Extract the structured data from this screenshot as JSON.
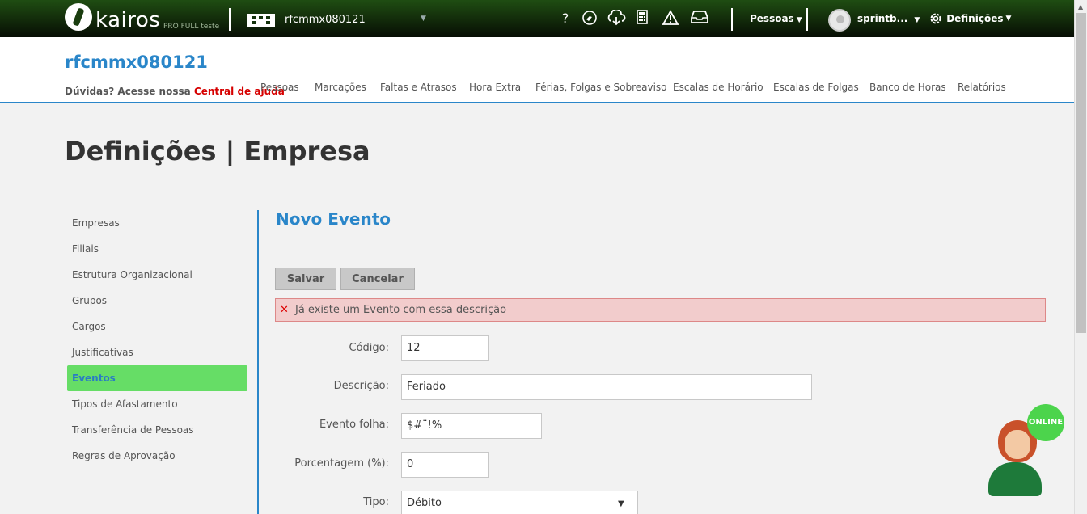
{
  "topbar": {
    "logo_text": "kairos",
    "logo_sub": "PRO FULL teste",
    "company": "rfcmmx080121",
    "icons": [
      "help-icon",
      "feedback-icon",
      "cloud-download-icon",
      "calculator-icon",
      "warning-icon",
      "inbox-icon"
    ],
    "help_glyph": "?",
    "pessoas_label": "Pessoas",
    "user_label": "sprintb...",
    "definicoes_label": "Definições"
  },
  "header": {
    "title": "rfcmmx080121",
    "help_prefix": "Dúvidas? Acesse nossa",
    "help_link": "Central de ajuda",
    "nav": [
      "Pessoas",
      "Marcações",
      "Faltas e Atrasos",
      "Hora Extra",
      "Férias, Folgas e Sobreaviso",
      "Escalas de Horário",
      "Escalas de Folgas",
      "Banco de Horas",
      "Relatórios"
    ]
  },
  "page_title": "Definições | Empresa",
  "sidebar": {
    "items": [
      "Empresas",
      "Filiais",
      "Estrutura Organizacional",
      "Grupos",
      "Cargos",
      "Justificativas",
      "Eventos",
      "Tipos de Afastamento",
      "Transferência de Pessoas",
      "Regras de Aprovação"
    ],
    "active": "Eventos"
  },
  "form": {
    "title": "Novo Evento",
    "save_label": "Salvar",
    "cancel_label": "Cancelar",
    "alert": "Já existe um Evento com essa descrição",
    "fields": {
      "codigo": {
        "label": "Código:",
        "value": "12"
      },
      "descricao": {
        "label": "Descrição:",
        "value": "Feriado"
      },
      "evento_folha": {
        "label": "Evento folha:",
        "value": "$#¨!%"
      },
      "porcentagem": {
        "label": "Porcentagem (%):",
        "value": "0"
      },
      "tipo": {
        "label": "Tipo:",
        "value": "Débito"
      }
    }
  },
  "chat": {
    "status": "ONLINE"
  },
  "colors": {
    "accent": "#2a86c9",
    "active_green": "#66dd66",
    "alert_red": "#d60000"
  }
}
